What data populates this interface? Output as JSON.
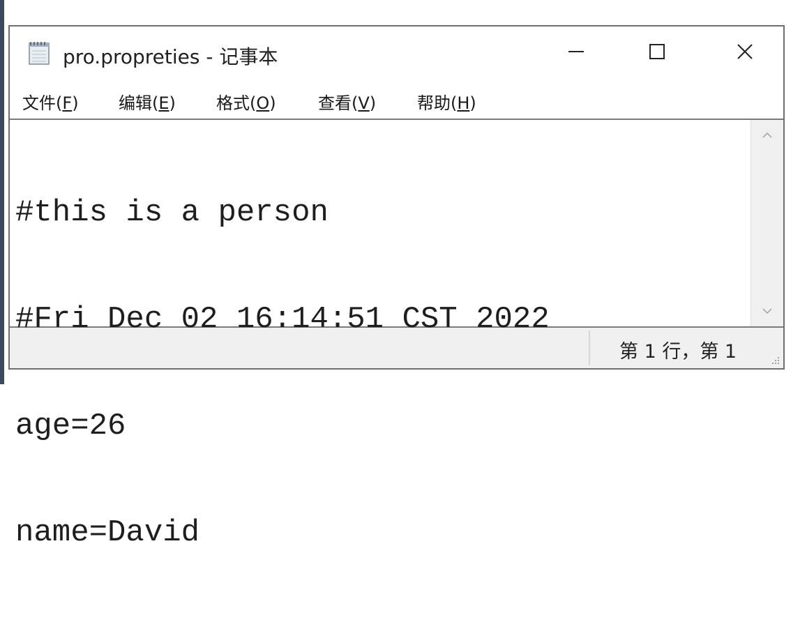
{
  "window": {
    "title": "pro.propreties - 记事本"
  },
  "menu": [
    {
      "label": "文件(",
      "key": "F",
      "close": ")"
    },
    {
      "label": "编辑(",
      "key": "E",
      "close": ")"
    },
    {
      "label": "格式(",
      "key": "O",
      "close": ")"
    },
    {
      "label": "查看(",
      "key": "V",
      "close": ")"
    },
    {
      "label": "帮助(",
      "key": "H",
      "close": ")"
    }
  ],
  "editor": {
    "lines": [
      "#this is a person",
      "#Fri Dec 02 16:14:51 CST 2022",
      "age=26",
      "name=David"
    ]
  },
  "status": {
    "position": "第 1 行，第 1"
  },
  "icons": {
    "app": "notepad-icon",
    "minimize": "minimize-icon",
    "maximize": "maximize-icon",
    "close": "close-icon",
    "scroll_up": "chevron-up-icon",
    "scroll_down": "chevron-down-icon",
    "resize": "resize-grip-icon"
  }
}
